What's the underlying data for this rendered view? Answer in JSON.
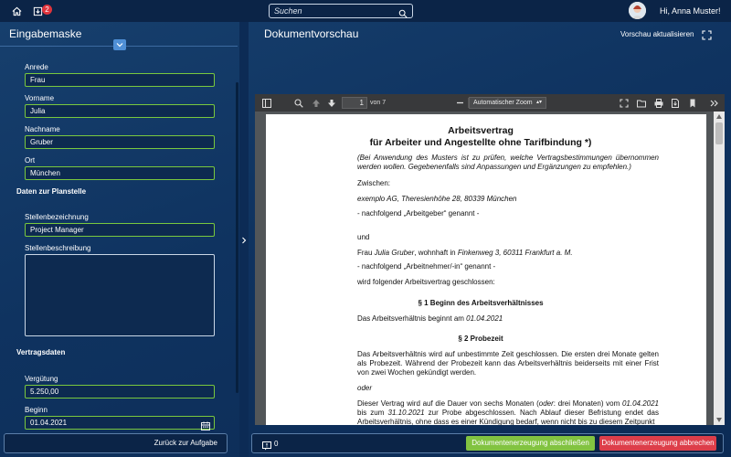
{
  "topbar": {
    "notifications_count": "2",
    "search_placeholder": "Suchen",
    "greeting": "Hi, Anna Muster!"
  },
  "left_panel": {
    "title": "Eingabemaske",
    "fields": {
      "anrede": {
        "label": "Anrede",
        "value": "Frau"
      },
      "vorname": {
        "label": "Vorname",
        "value": "Julia"
      },
      "nachname": {
        "label": "Nachname",
        "value": "Gruber"
      },
      "ort": {
        "label": "Ort",
        "value": "München"
      }
    },
    "section_planstelle": "Daten zur Planstelle",
    "stellenbezeichnung": {
      "label": "Stellenbezeichnung",
      "value": "Project Manager"
    },
    "stellenbeschreibung": {
      "label": "Stellenbeschreibung",
      "value": ""
    },
    "section_vertrag": "Vertragsdaten",
    "verguetung": {
      "label": "Vergütung",
      "value": "5.250,00"
    },
    "beginn": {
      "label": "Beginn",
      "value": "01.04.2021"
    },
    "back_button": "Zurück zur Aufgabe"
  },
  "right_panel": {
    "title": "Dokumentvorschau",
    "refresh_label": "Vorschau aktualisieren",
    "viewer": {
      "page_number": "1",
      "page_of": "von 7",
      "zoom_label": "Automatischer Zoom"
    },
    "document": {
      "title1": "Arbeitsvertrag",
      "title2": "für Arbeiter und Angestellte ohne Tarifbindung *)",
      "note": "(Bei Anwendung des Musters ist zu prüfen, welche Vertragsbestimmungen übernommen werden wollen. Gegebenenfalls sind Anpassungen und Ergänzungen zu empfehlen.)",
      "zwischen": "Zwischen:",
      "employer": "exemplo AG, Theresienhöhe 28, 80339 München",
      "employer_note": "- nachfolgend „Arbeitgeber“ genannt -",
      "und": "und",
      "employee_prefix": "Frau ",
      "employee_name": "Julia Gruber",
      "employee_mid": ", wohnhaft in ",
      "employee_address": "Finkenweg 3, 60311 Frankfurt a. M.",
      "employee_note": "- nachfolgend „Arbeitnehmer/-in“ genannt -",
      "closing": "wird folgender Arbeitsvertrag geschlossen:",
      "s1_title": "§ 1 Beginn des Arbeitsverhältnisses",
      "s1_text": "Das Arbeitsverhältnis beginnt am ",
      "s1_date": "01.04.2021",
      "s2_title": "§ 2 Probezeit",
      "s2_text": "Das Arbeitsverhältnis wird auf unbestimmte Zeit geschlossen. Die ersten drei Monate gelten als Probezeit. Während der Probezeit kann das Arbeitsverhältnis beiderseits mit einer Frist von zwei Wochen gekündigt werden.",
      "oder": "oder",
      "s2_alt_a": "Dieser Vertrag wird auf die Dauer von sechs Monaten (",
      "s2_alt_oder": "oder",
      "s2_alt_b": ": drei Monaten) vom ",
      "s2_alt_date1": "01.04.2021",
      "s2_alt_c": " bis zum ",
      "s2_alt_date2": "31.10.2021",
      "s2_alt_d": " zur Probe abgeschlossen. Nach Ablauf dieser Befristung endet das Arbeitsverhältnis, ohne dass es einer Kündigung bedarf, wenn nicht bis zu diesem Zeitpunkt"
    },
    "messages_count": "0",
    "complete_button": "Dokumentenerzeugung abschließen",
    "cancel_button": "Dokumentenerzeugung abbrechen"
  },
  "colors": {
    "background": "#0f3360",
    "field_border": "#79c83e",
    "success": "#82c341",
    "danger": "#dd3e4a",
    "badge": "#e0343c"
  },
  "icons": [
    "home-icon",
    "inbox-icon",
    "search-icon",
    "chevron-down-icon",
    "chevron-right-icon",
    "fullscreen-icon",
    "calendar-icon",
    "message-icon"
  ]
}
